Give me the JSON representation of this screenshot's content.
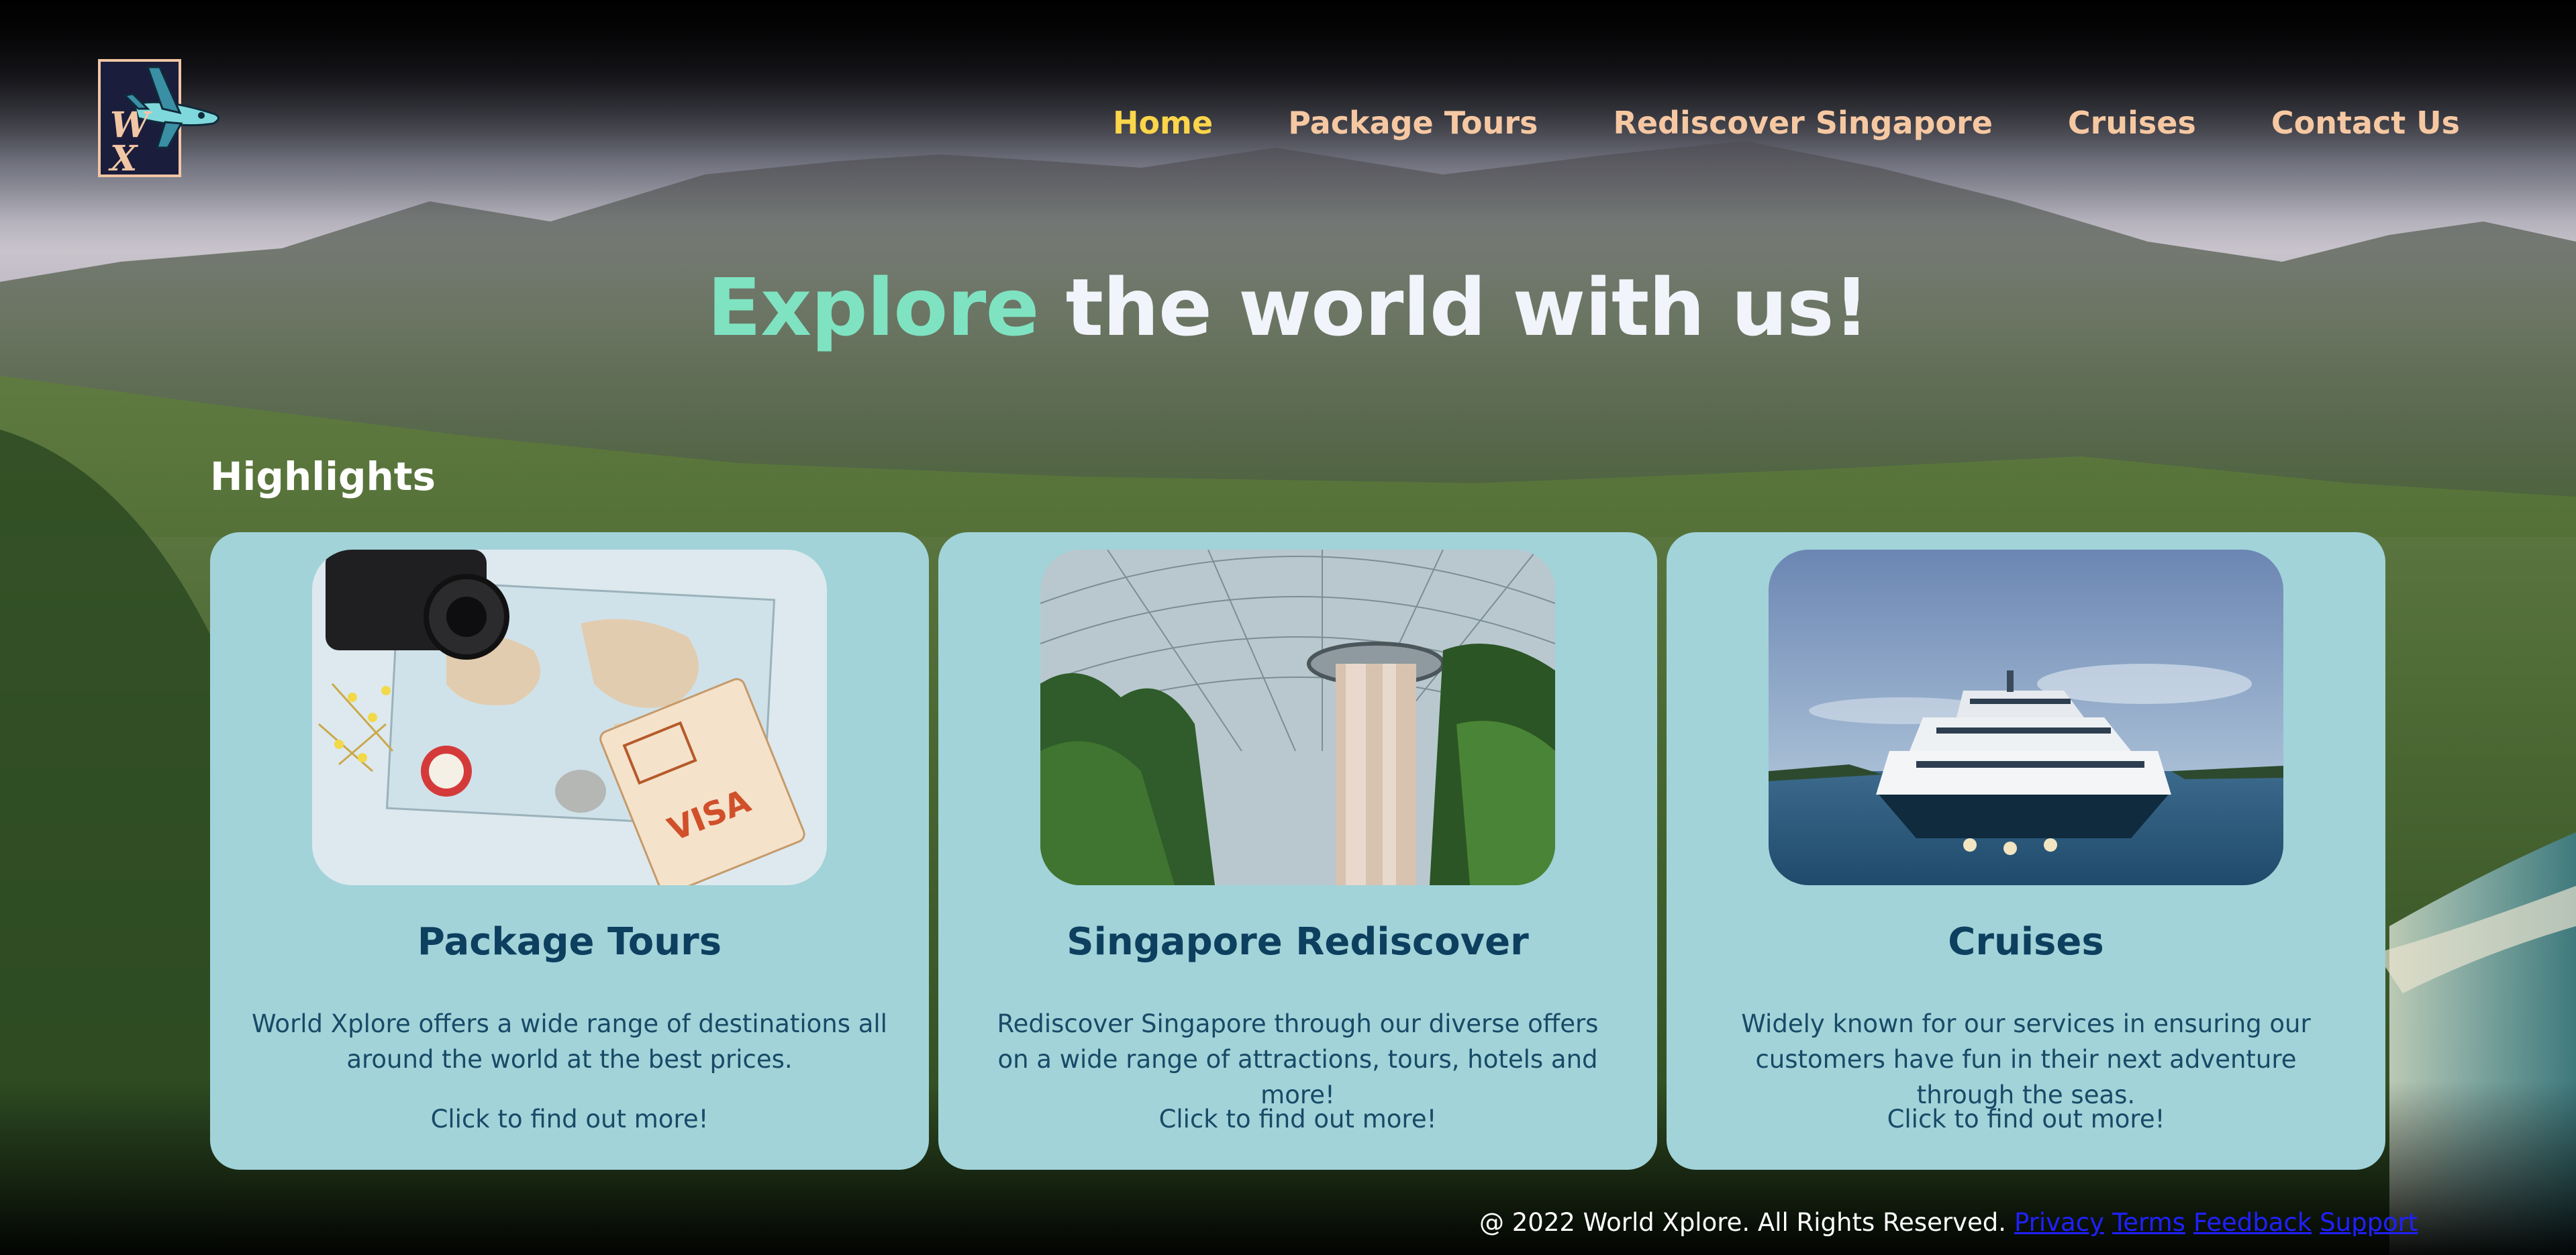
{
  "logo": {
    "letters": [
      "W",
      "X"
    ]
  },
  "nav": {
    "items": [
      {
        "label": "Home",
        "active": true
      },
      {
        "label": "Package Tours",
        "active": false
      },
      {
        "label": "Rediscover Singapore",
        "active": false
      },
      {
        "label": "Cruises",
        "active": false
      },
      {
        "label": "Contact Us",
        "active": false
      }
    ]
  },
  "hero": {
    "accent": "Explore",
    "rest": " the world with us!"
  },
  "highlights": {
    "heading": "Highlights",
    "cards": [
      {
        "image": "travel-map-camera-passport",
        "title": "Package Tours",
        "description": "World Xplore offers a wide range of destinations all around the world at the best prices.",
        "cta": "Click to find out more!"
      },
      {
        "image": "indoor-waterfall-dome",
        "title": "Singapore Rediscover",
        "description": "Rediscover Singapore through our diverse offers on a wide range of attractions, tours, hotels and more!",
        "cta": "Click to find out more!"
      },
      {
        "image": "white-ferry-on-sea",
        "title": "Cruises",
        "description": "Widely known for our services in ensuring our customers have fun in their next adventure through the seas.",
        "cta": "Click to find out more!"
      }
    ]
  },
  "footer": {
    "copyright": "@ 2022 World Xplore. All Rights Reserved.",
    "links": [
      "Privacy",
      "Terms",
      "Feedback",
      "Support"
    ]
  },
  "colors": {
    "nav_text": "#f6c8a2",
    "nav_active": "#fbd54a",
    "hero_accent": "#7fe3c2",
    "card_bg": "#a1d3d9",
    "card_text": "#0d3f5f",
    "footer_link": "#2020ff"
  }
}
